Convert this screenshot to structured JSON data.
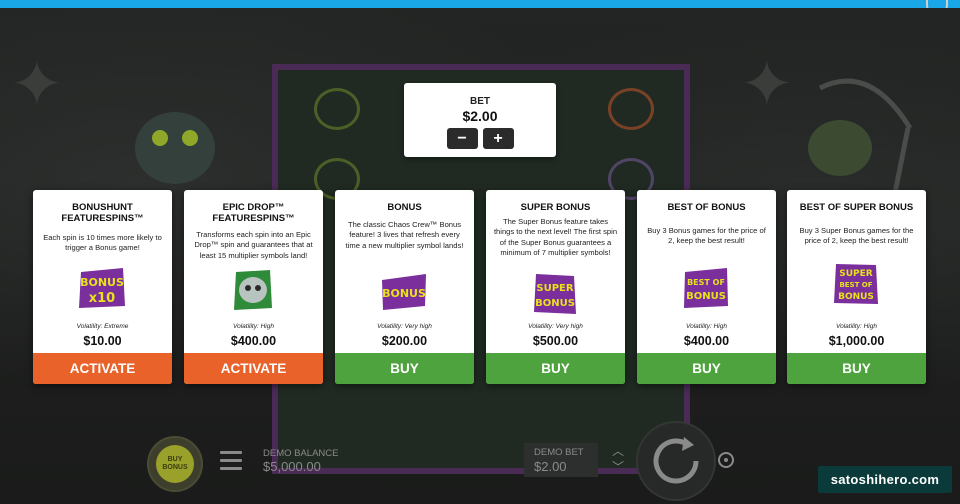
{
  "bet_panel": {
    "label": "BET",
    "value": "$2.00",
    "minus_label": "−",
    "plus_label": "+"
  },
  "cards": [
    {
      "title": "BONUSHUNT FEATURESPINS™",
      "description": "Each spin is 10 times more likely to trigger a Bonus game!",
      "logo_text": [
        "BONUS",
        "x10"
      ],
      "volatility": "Volatility: Extreme",
      "price": "$10.00",
      "button": "ACTIVATE"
    },
    {
      "title": "EPIC DROP™ FEATURESPINS™",
      "description": "Transforms each spin into an Epic Drop™ spin and guarantees that at least 15 multiplier symbols land!",
      "logo_text": [],
      "volatility": "Volatility: High",
      "price": "$400.00",
      "button": "ACTIVATE"
    },
    {
      "title": "BONUS",
      "description": "The classic Chaos Crew™ Bonus feature! 3 lives that refresh every time a new multiplier symbol lands!",
      "logo_text": [
        "BONUS"
      ],
      "volatility": "Volatility: Very high",
      "price": "$200.00",
      "button": "BUY"
    },
    {
      "title": "SUPER BONUS",
      "description": "The Super Bonus feature takes things to the next level! The first spin of the Super Bonus guarantees a minimum of 7 multiplier symbols!",
      "logo_text": [
        "SUPER",
        "BONUS"
      ],
      "volatility": "Volatility: Very high",
      "price": "$500.00",
      "button": "BUY"
    },
    {
      "title": "BEST OF BONUS",
      "description": "Buy 3 Bonus games for the price of 2, keep the best result!",
      "logo_text": [
        "BEST OF",
        "BONUS"
      ],
      "volatility": "Volatility: High",
      "price": "$400.00",
      "button": "BUY"
    },
    {
      "title": "BEST OF SUPER BONUS",
      "description": "Buy 3 Super Bonus games for the price of 2, keep the best result!",
      "logo_text": [
        "SUPER",
        "BEST OF",
        "BONUS"
      ],
      "volatility": "Volatility: High",
      "price": "$1,000.00",
      "button": "BUY"
    }
  ],
  "bottom_bar": {
    "buy_bonus_label": "BUY BONUS",
    "demo_balance_label": "DEMO BALANCE",
    "demo_balance_value": "$5,000.00",
    "demo_bet_label": "DEMO BET",
    "demo_bet_value": "$2.00"
  },
  "watermark": "satoshihero.com",
  "colors": {
    "activate": "#e8622a",
    "buy": "#4fa33e",
    "topbar": "#19a7e8",
    "logo_purple": "#7a2f9c",
    "logo_yellow": "#e8e21a"
  }
}
